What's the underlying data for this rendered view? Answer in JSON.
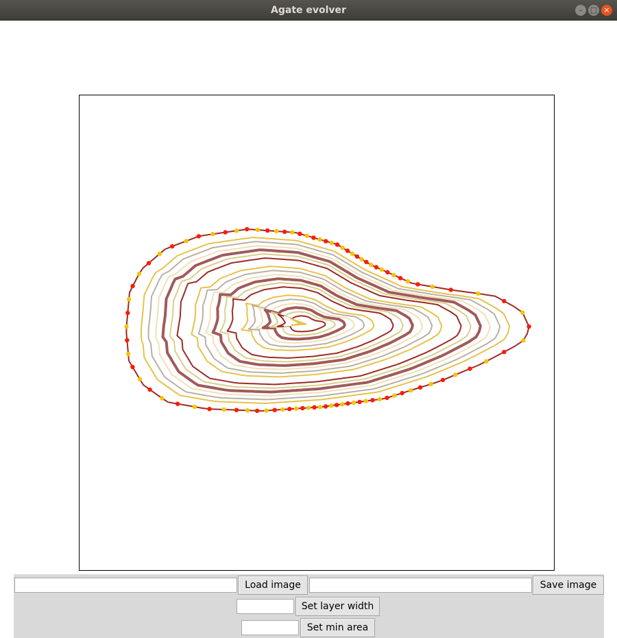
{
  "window": {
    "title": "Agate evolver",
    "buttons": {
      "minimize": "–",
      "maximize": "□",
      "close": "×"
    }
  },
  "controls": {
    "image_path_value": "",
    "load_image_label": "Load image",
    "save_path_value": "",
    "save_image_label": "Save image",
    "layer_width_value": "",
    "set_layer_width_label": "Set layer width",
    "min_area_value": "",
    "set_min_area_label": "Set min area"
  },
  "agate": {
    "band_colors": [
      "#9b2a26",
      "#ffffff",
      "#e6c24b",
      "#b8b0a6",
      "#f1e0b8",
      "#a05a5a",
      "#d9cf8a"
    ],
    "outline_dot_colors": [
      "#ff1a00",
      "#f5c400"
    ],
    "core_fill": "#eee28e"
  }
}
